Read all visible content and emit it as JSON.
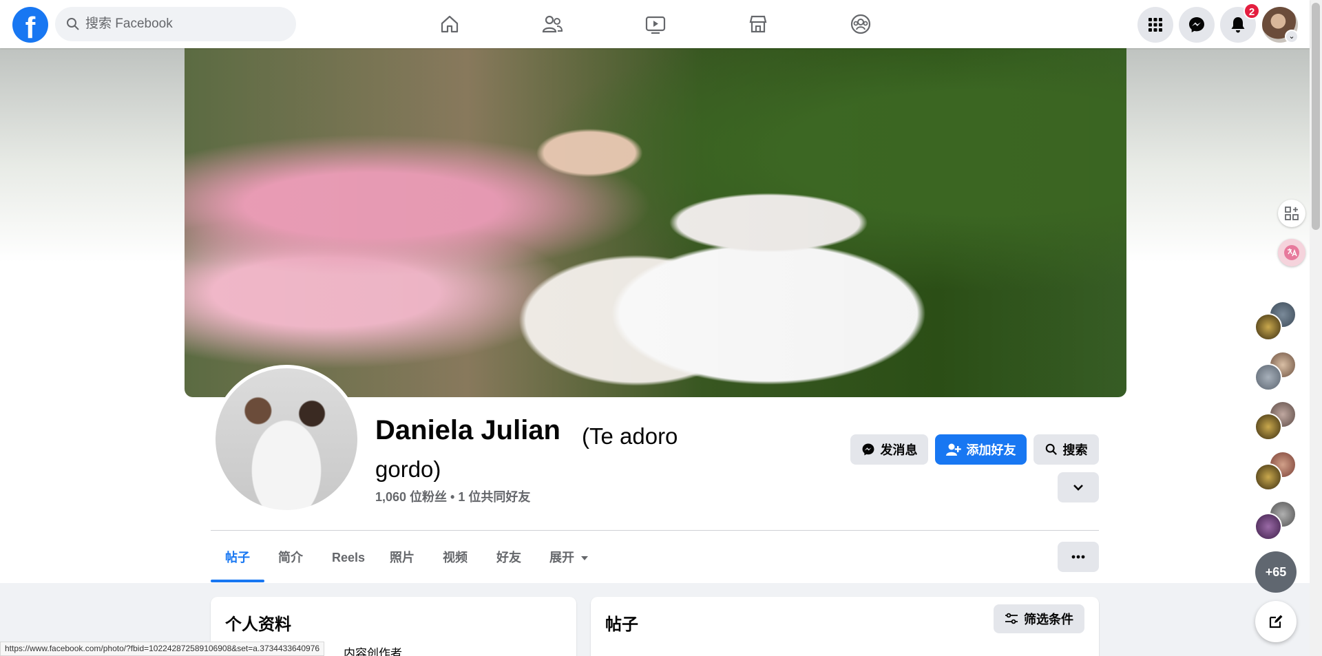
{
  "search": {
    "placeholder": "搜索 Facebook"
  },
  "topnav": {
    "icons": [
      "home-icon",
      "friends-icon",
      "watch-icon",
      "marketplace-icon",
      "groups-icon"
    ],
    "notification_count": "2"
  },
  "profile": {
    "name": "Daniela Julian",
    "nickname": "(Te adoro gordo)",
    "stats": "1,060 位粉丝 • 1 位共同好友"
  },
  "actions": {
    "message": "发消息",
    "add_friend": "添加好友",
    "search": "搜索"
  },
  "tabs": [
    "帖子",
    "简介",
    "Reels",
    "照片",
    "视频",
    "好友",
    "展开"
  ],
  "intro": {
    "title": "个人资料",
    "partial_text": "内容创作者"
  },
  "posts": {
    "title": "帖子",
    "filter": "筛选条件"
  },
  "contacts": {
    "more": "+65"
  },
  "status_url": "https://www.facebook.com/photo/?fbid=102242872589106908&set=a.3734433640976",
  "colors": {
    "brand": "#1877f2",
    "badge": "#e41e3f"
  }
}
